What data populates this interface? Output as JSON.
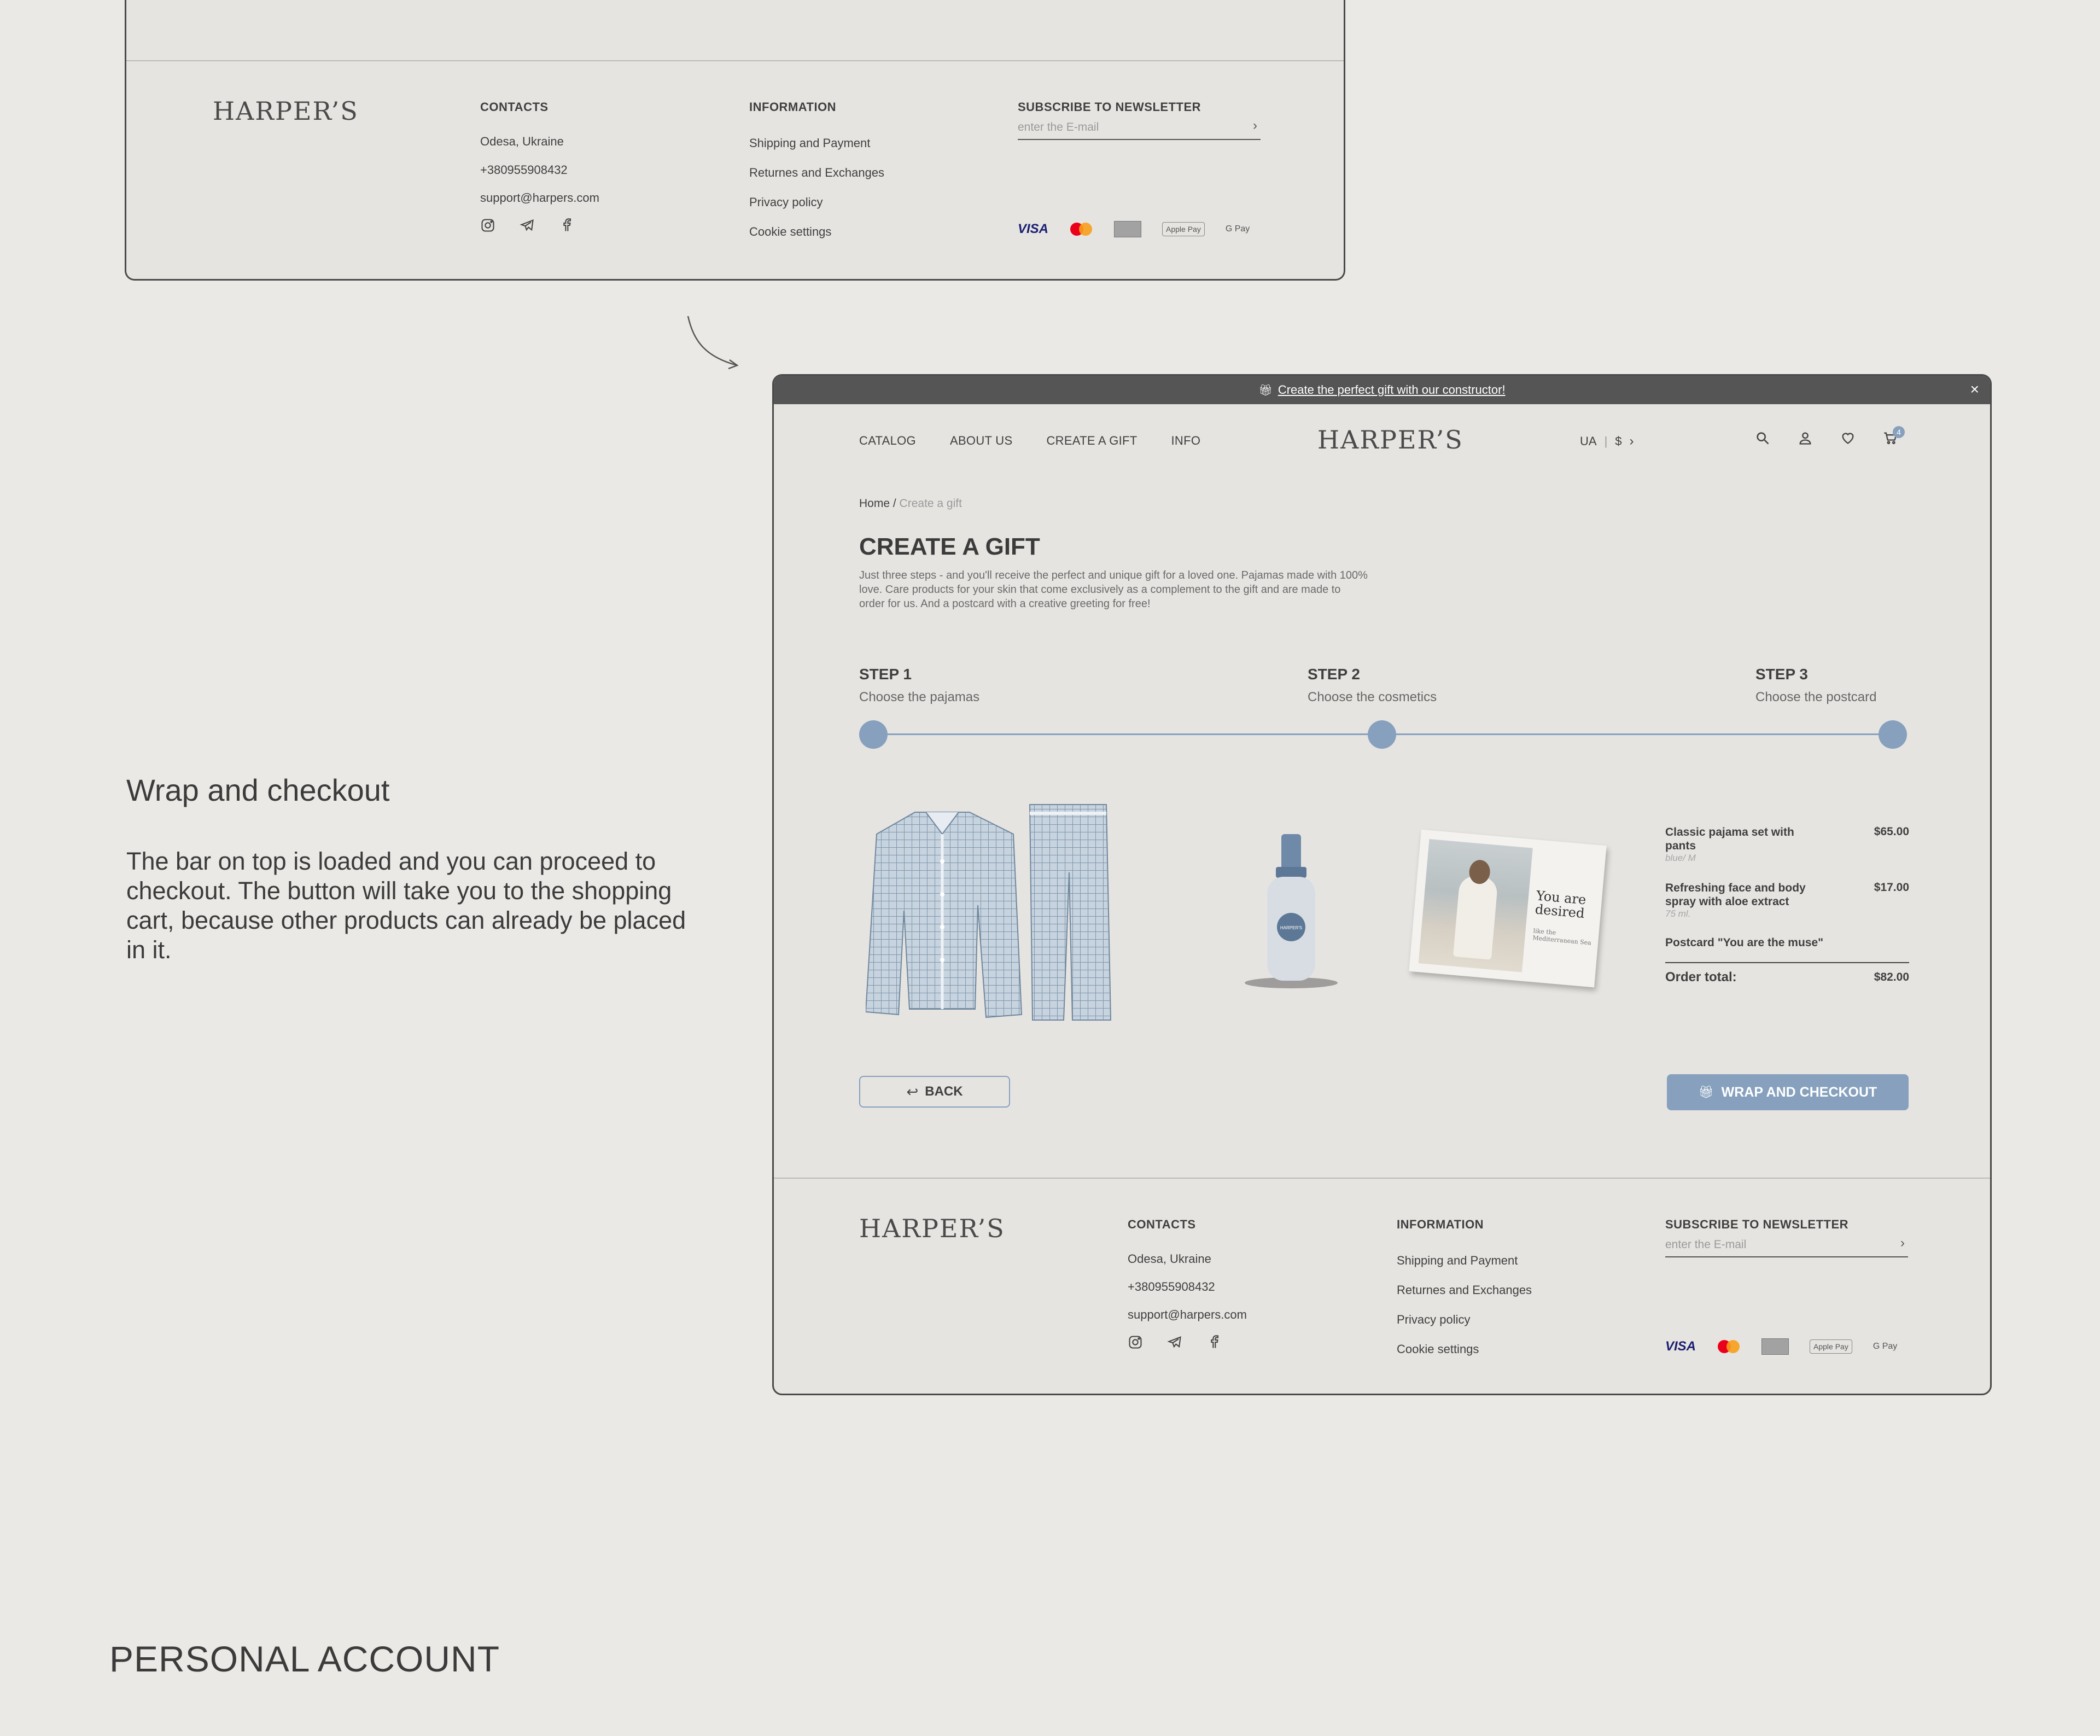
{
  "colors": {
    "accent": "#86a0bd",
    "banner": "#555555",
    "background": "#ebe9e6",
    "frame": "#e6e4e1"
  },
  "footer": {
    "logo": "HARPER’S",
    "contacts_title": "CONTACTS",
    "city": "Odesa, Ukraine",
    "phone": "+380955908432",
    "email": "support@harpers.com",
    "social_icons": [
      "instagram-icon",
      "telegram-icon",
      "facebook-icon"
    ],
    "information_title": "INFORMATION",
    "links": [
      "Shipping and Payment",
      "Returnes and Exchanges",
      "Privacy policy",
      "Cookie settings"
    ],
    "newsletter_title": "SUBSCRIBE TO NEWSLETTER",
    "newsletter_placeholder": "enter the E-mail",
    "payments": [
      "VISA",
      "mastercard",
      "amex",
      "Apple Pay",
      "G Pay"
    ]
  },
  "description": {
    "title": "Wrap and checkout",
    "body": "The bar on top is loaded and you can proceed to checkout. The button will take you to the shopping cart, because other products can already be placed in it."
  },
  "section_title": "PERSONAL ACCOUNT",
  "banner": {
    "text": "Create the perfect gift with our constructor!"
  },
  "nav": {
    "links": [
      "CATALOG",
      "ABOUT US",
      "CREATE A GIFT",
      "INFO"
    ],
    "logo": "HARPER’S",
    "lang": "UA",
    "currency": "$",
    "cart_count": "4"
  },
  "breadcrumb": {
    "home": "Home",
    "separator": " / ",
    "current": "Create a gift"
  },
  "page": {
    "title": "CREATE A GIFT",
    "intro": "Just three steps - and you'll receive the perfect and unique gift for a loved one. Pajamas made with 100% love. Care products for your skin that come exclusively as a complement to the gift and are made to order for us. And a postcard with a creative greeting for free!"
  },
  "steps": [
    {
      "title": "STEP 1",
      "subtitle": "Choose the pajamas"
    },
    {
      "title": "STEP 2",
      "subtitle": "Choose the cosmetics"
    },
    {
      "title": "STEP 3",
      "subtitle": "Choose the postcard"
    }
  ],
  "postcard": {
    "headline": "You are desired",
    "caption": "like the Mediterranean Sea"
  },
  "bottle_label": "HARPER'S",
  "summary": {
    "items": [
      {
        "name": "Classic pajama set with pants",
        "sub": "blue/ M",
        "price": "$65.00"
      },
      {
        "name": "Refreshing face and body spray with aloe extract",
        "sub": "75 ml.",
        "price": "$17.00"
      },
      {
        "name": "Postcard \"You are the muse\"",
        "sub": "",
        "price": ""
      }
    ],
    "total_label": "Order total:",
    "total_value": "$82.00"
  },
  "buttons": {
    "back": "BACK",
    "checkout": "WRAP AND CHECKOUT"
  }
}
